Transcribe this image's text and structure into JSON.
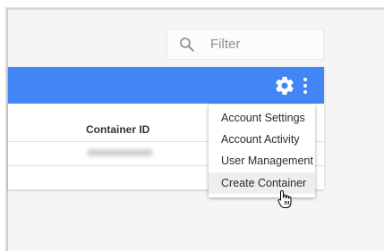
{
  "filter": {
    "placeholder": "Filter"
  },
  "table": {
    "column_header": "Container ID",
    "rows": [
      {
        "container_id": ""
      }
    ]
  },
  "toolbar": {
    "gear_icon": "gear-icon",
    "more_icon": "more-vert-icon"
  },
  "menu": {
    "items": [
      {
        "label": "Account Settings"
      },
      {
        "label": "Account Activity"
      },
      {
        "label": "User Management"
      },
      {
        "label": "Create Container"
      }
    ],
    "hovered_item": "Create Container"
  },
  "colors": {
    "header_blue": "#4285f4",
    "frame_bg": "#f5f5f5",
    "menu_hover": "#eeeeee"
  }
}
